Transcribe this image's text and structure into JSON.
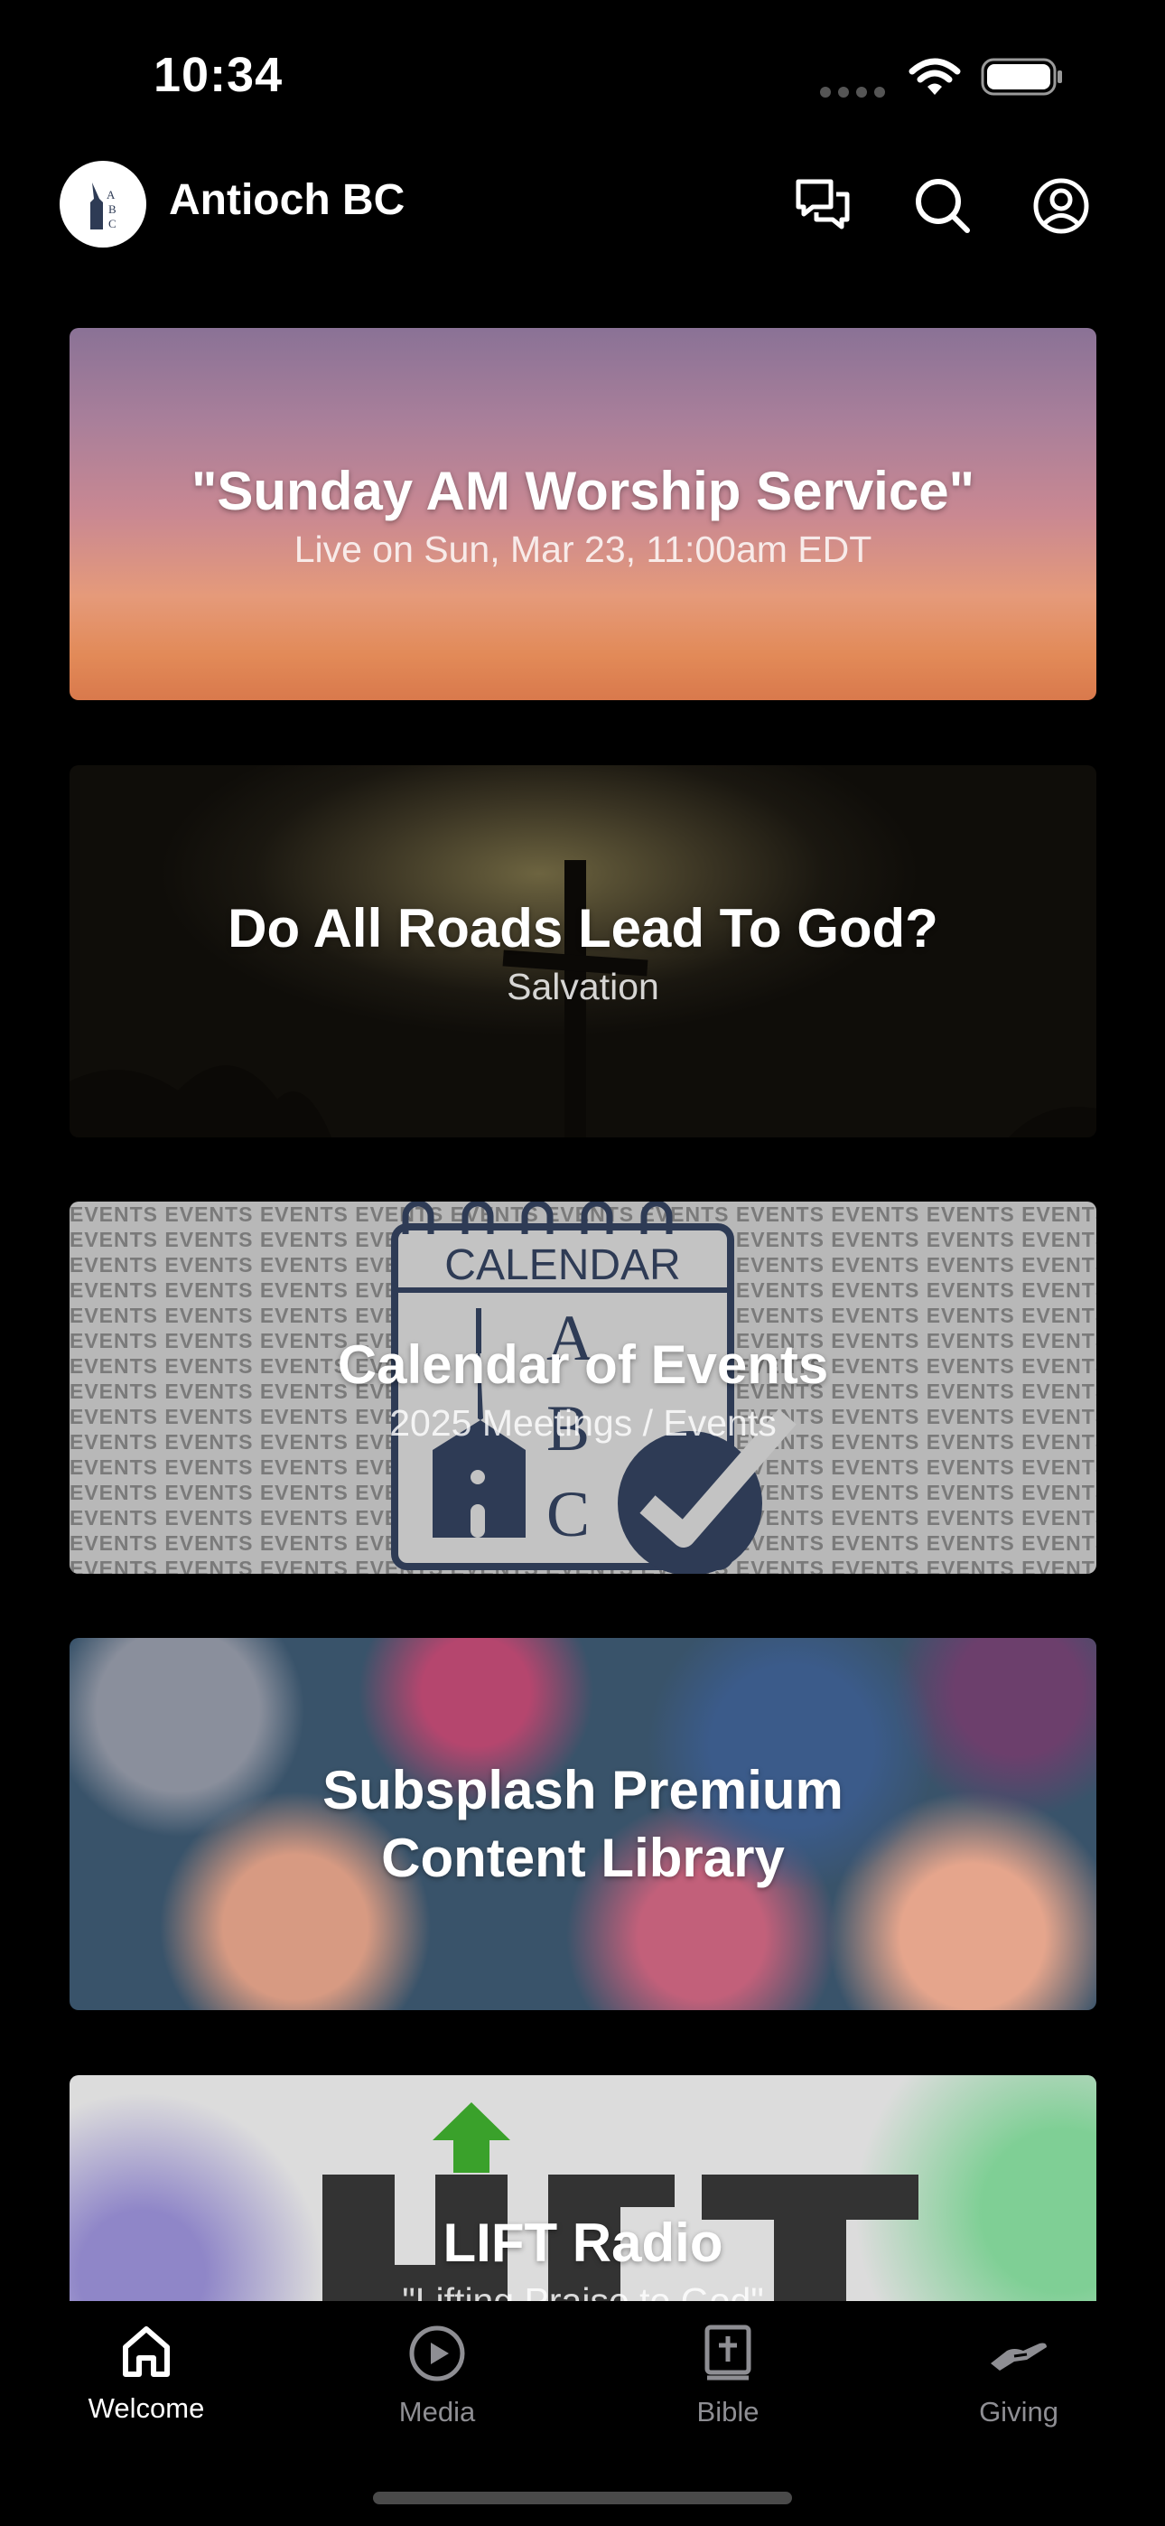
{
  "status_bar": {
    "time": "10:34"
  },
  "header": {
    "title": "Antioch BC",
    "logo_letters": "ABC",
    "icons": [
      "chat-icon",
      "search-icon",
      "profile-icon"
    ]
  },
  "cards": [
    {
      "title": "\"Sunday AM Worship Service\"",
      "subtitle": "Live on Sun, Mar 23, 11:00am EDT"
    },
    {
      "title": "Do All Roads Lead To God?",
      "subtitle": "Salvation"
    },
    {
      "title": "Calendar of Events",
      "subtitle": "2025 Meetings / Events",
      "image_heading": "CALENDAR",
      "pattern_word": "EVENTS"
    },
    {
      "title": "Subsplash Premium Content Library",
      "subtitle": ""
    },
    {
      "title": "LIFT Radio",
      "subtitle": "\"Lifting Praise to God\""
    }
  ],
  "tabbar": {
    "tabs": [
      {
        "label": "Welcome",
        "icon": "home-icon",
        "active": true
      },
      {
        "label": "Media",
        "icon": "play-circle-icon",
        "active": false
      },
      {
        "label": "Bible",
        "icon": "bible-icon",
        "active": false
      },
      {
        "label": "Giving",
        "icon": "giving-hand-icon",
        "active": false
      }
    ]
  },
  "colors": {
    "background": "#000000",
    "active_tab": "#ffffff",
    "inactive_tab": "#8e8e93",
    "lift_arrow": "#3aa12b"
  }
}
